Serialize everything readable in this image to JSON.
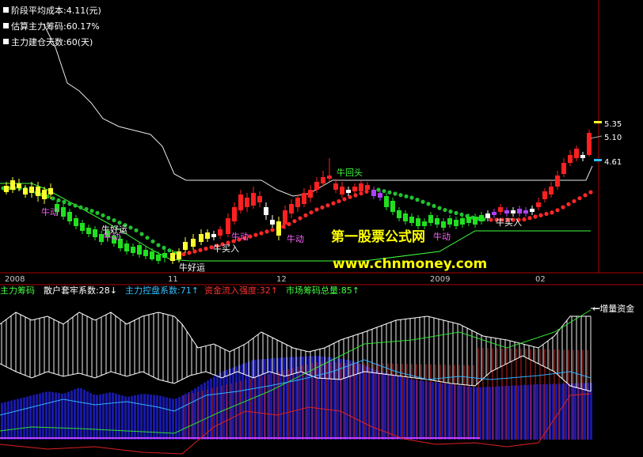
{
  "info": {
    "avg_cost": "阶段平均成本:4.11(元)",
    "main_chips": "估算主力筹码:60.17%",
    "build_days": "主力建仓天数:60(天)"
  },
  "price_labels": {
    "high": "5.35",
    "mid": "5.10",
    "low": "4.61"
  },
  "annotations": {
    "niudong": "牛动",
    "niuhaoyun": "牛好运",
    "niumairu": "牛买入",
    "niuhuitou": "牛回头"
  },
  "dates": [
    "2008",
    "11",
    "12",
    "2009",
    "02"
  ],
  "indicator": {
    "name": "主力筹码",
    "retail": "散户套牢系数:28↓",
    "control": "主力控盘系数:71↑",
    "inflow": "资金流入强度:32↑",
    "market": "市场筹码总量:85↑",
    "added_funds": "←增量资金"
  },
  "watermark": {
    "line1": "第一股票公式网",
    "line2": "www.chnmoney.com"
  },
  "colors": {
    "up": "#ff2020",
    "down": "#20e020",
    "yellow": "#ffff30",
    "cyan": "#30c0ff",
    "purple": "#b040ff",
    "blue": "#2020b0",
    "white": "#ffffff"
  }
}
